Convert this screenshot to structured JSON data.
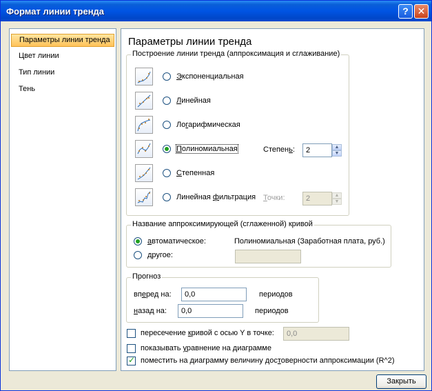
{
  "window": {
    "title": "Формат линии тренда",
    "help_glyph": "?",
    "close_glyph": "✕"
  },
  "nav": {
    "items": [
      {
        "label": "Параметры линии тренда",
        "selected": true
      },
      {
        "label": "Цвет линии"
      },
      {
        "label": "Тип линии"
      },
      {
        "label": "Тень"
      }
    ]
  },
  "main": {
    "heading": "Параметры линии тренда",
    "type_group": {
      "legend": "Построение линии тренда (аппроксимация и сглаживание)",
      "options": [
        {
          "pre": "",
          "ul": "Э",
          "post": "кспоненциальная",
          "icon": "exponential-trend-icon"
        },
        {
          "pre": "",
          "ul": "Л",
          "post": "инейная",
          "icon": "linear-trend-icon"
        },
        {
          "pre": "Ло",
          "ul": "г",
          "post": "арифмическая",
          "icon": "logarithmic-trend-icon"
        },
        {
          "pre": "",
          "ul": "П",
          "post": "олиномиальная",
          "icon": "polynomial-trend-icon",
          "selected": true
        },
        {
          "pre": "",
          "ul": "С",
          "post": "тепенная",
          "icon": "power-trend-icon"
        },
        {
          "pre": "Линейная ",
          "ul": "ф",
          "post": "ильтрация",
          "icon": "moving-average-trend-icon"
        }
      ],
      "degree": {
        "pre": "Степен",
        "ul": "ь",
        "post": ":",
        "value": "2"
      },
      "period": {
        "ul": "Т",
        "post": "очки:",
        "value": "2"
      }
    },
    "name_group": {
      "legend": "Название аппроксимирующей (сглаженной) кривой",
      "auto": {
        "ul": "а",
        "post": "втоматическое:",
        "selected": true
      },
      "auto_value": "Полиномиальная (Заработная плата, руб.)",
      "custom": {
        "ul": "д",
        "post": "ругое:"
      },
      "custom_value": ""
    },
    "forecast": {
      "legend": "Прогноз",
      "forward": {
        "pre": "вп",
        "ul": "е",
        "post": "ред на:",
        "value": "0,0",
        "unit": "периодов"
      },
      "backward": {
        "pre": "",
        "ul": "н",
        "post": "азад на:",
        "value": "0,0",
        "unit": "периодов"
      }
    },
    "intercept": {
      "pre": "пересечение ",
      "ul": "к",
      "post": "ривой с осью Y в точке:",
      "value": "0,0",
      "checked": false
    },
    "show_equation": {
      "pre": "показывать ",
      "ul": "у",
      "post": "равнение на диаграмме",
      "checked": false
    },
    "show_r2": {
      "pre": "поместить на диаграмму величину дос",
      "ul": "т",
      "post": "оверности аппроксимации (R^2)",
      "checked": true
    }
  },
  "buttons": {
    "close": "Закрыть"
  }
}
